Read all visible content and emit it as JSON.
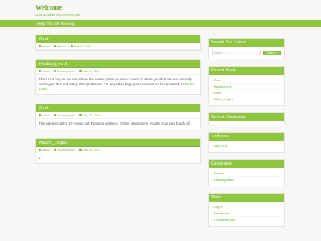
{
  "site": {
    "title": "Welcome",
    "description": "Just another WordPress site"
  },
  "nav": {
    "item": "Keep The Site Running"
  },
  "posts": [
    {
      "title": "Root",
      "author": "admin",
      "category": "Review",
      "date": "May 29, 2019",
      "body": "",
      "read_more": ""
    },
    {
      "title": "Working on it",
      "author": "admin",
      "category": "Uncategorized",
      "date": "May 25, 2019",
      "body": "There is a bug on our site where the review posts go twice. I want to inform you that we are currently working on this and many other problems. For any other bugs just comment on this post and we",
      "read_more": "Read more..."
    },
    {
      "title": "Root",
      "author": "admin",
      "category": "Uncategorized",
      "date": "May 25, 2019",
      "body": "This game is ok for 17+ years old. Fictional violence. Online interactions. Nudity. Can turn buddy off.",
      "read_more": ""
    },
    {
      "title": "Watch_Dogs2",
      "author": "admin",
      "category": "Uncategorized",
      "date": "May 24, 2019",
      "body": "V",
      "read_more": ""
    }
  ],
  "sidebar": {
    "search": {
      "title": "Search For Games",
      "placeholder": "Search ...",
      "button": "Search »"
    },
    "recent_posts": {
      "title": "Recent Posts",
      "items": [
        "Root",
        "Working on it",
        "Root",
        "Watch_Dogs2"
      ]
    },
    "recent_comments": {
      "title": "Recent Comments"
    },
    "archives": {
      "title": "Archives",
      "items": [
        "May 2019"
      ]
    },
    "categories": {
      "title": "Categories",
      "items": [
        "Review",
        "Uncategorized"
      ]
    },
    "meta": {
      "title": "Meta",
      "items": [
        "Log in",
        "Entries feed",
        "Comments feed"
      ]
    }
  },
  "colors": {
    "accent": "#8ec63f",
    "link": "#6aa62a",
    "background": "#f7f7f5"
  }
}
